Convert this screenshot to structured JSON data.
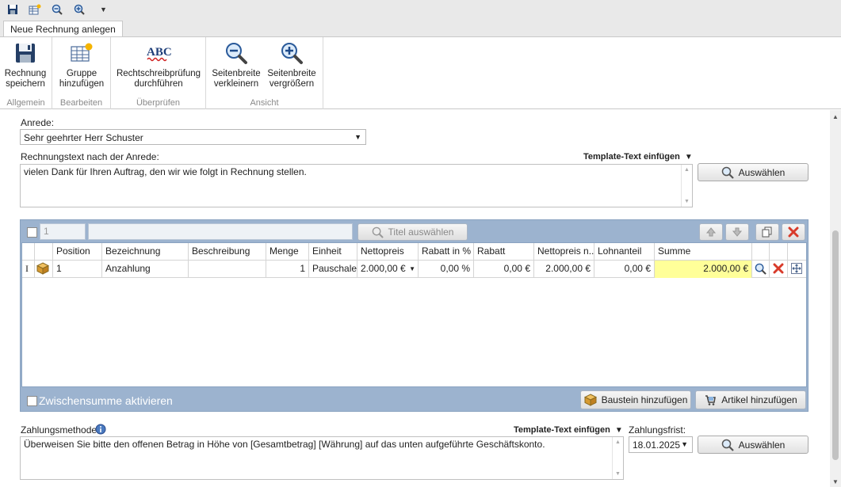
{
  "ribbon": {
    "tab": "Neue Rechnung anlegen",
    "groups": [
      {
        "label": "Allgemein",
        "buttons": [
          {
            "line1": "Rechnung",
            "line2": "speichern"
          }
        ]
      },
      {
        "label": "Bearbeiten",
        "buttons": [
          {
            "line1": "Gruppe",
            "line2": "hinzufügen"
          }
        ]
      },
      {
        "label": "Überprüfen",
        "buttons": [
          {
            "line1": "Rechtschreibprüfung",
            "line2": "durchführen"
          }
        ]
      },
      {
        "label": "Ansicht",
        "buttons": [
          {
            "line1": "Seitenbreite",
            "line2": "verkleinern"
          },
          {
            "line1": "Seitenbreite",
            "line2": "vergrößern"
          }
        ]
      }
    ],
    "spell_icon_text": "ABC"
  },
  "form": {
    "anrede_label": "Anrede:",
    "anrede_value": "Sehr geehrter Herr Schuster",
    "text_label": "Rechnungstext nach der Anrede:",
    "template_link": "Template-Text einfügen",
    "text_value": "vielen Dank für Ihren Auftrag, den wir wie folgt in Rechnung stellen.",
    "select_button": "Auswählen"
  },
  "panel": {
    "group_number": "1",
    "title_button": "Titel auswählen",
    "columns": [
      "",
      "",
      "Position",
      "Bezeichnung",
      "Beschreibung",
      "Menge",
      "Einheit",
      "Nettopreis",
      "Rabatt in %",
      "Rabatt",
      "Nettopreis n...",
      "Lohnanteil",
      "Summe",
      "",
      "",
      ""
    ],
    "row": {
      "marker": "I",
      "position": "1",
      "bezeichnung": "Anzahlung",
      "beschreibung": "",
      "menge": "1",
      "einheit": "Pauschale",
      "nettopreis": "2.000,00 €",
      "rabatt_prozent": "0,00 %",
      "rabatt": "0,00 €",
      "nettopreis_n": "2.000,00 €",
      "lohnanteil": "0,00 €",
      "summe": "2.000,00 €"
    },
    "subtotal_label": "Zwischensumme aktivieren",
    "baustein_button": "Baustein hinzufügen",
    "artikel_button": "Artikel hinzufügen"
  },
  "payment": {
    "method_label": "Zahlungsmethode:",
    "template_link": "Template-Text einfügen",
    "text_value": "Überweisen Sie bitte den offenen Betrag in Höhe von [Gesamtbetrag] [Währung] auf das unten aufgeführte Geschäftskonto.",
    "deadline_label": "Zahlungsfrist:",
    "deadline_value": "18.01.2025",
    "select_button": "Auswählen"
  },
  "colors": {
    "summe_highlight": "#ffff99",
    "panel_bg": "#9cb3cf",
    "delete_red": "#d83a2a"
  }
}
